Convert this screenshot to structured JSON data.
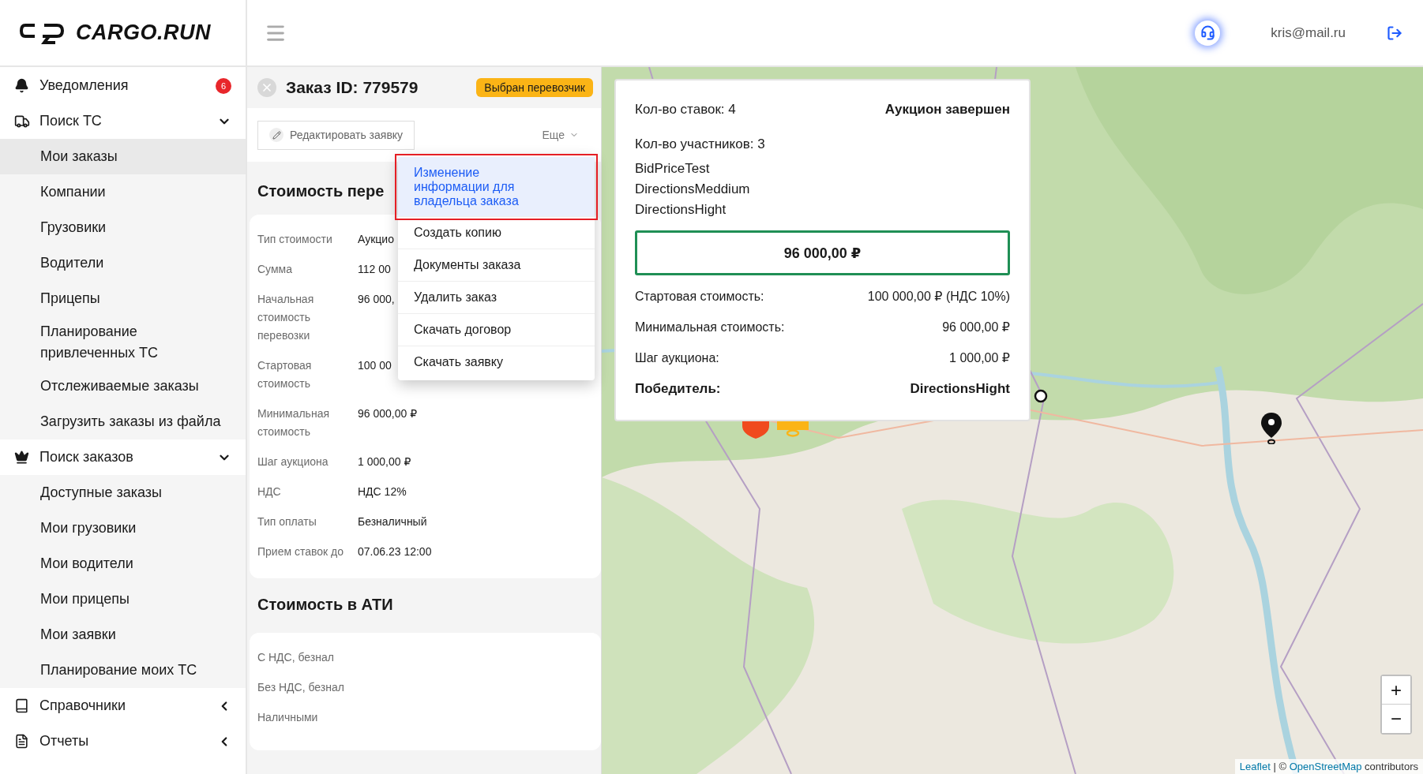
{
  "header": {
    "logo": "CARGO.RUN",
    "user_email": "kris@mail.ru"
  },
  "sidebar": {
    "items": [
      {
        "kind": "bell",
        "label": "Уведомления",
        "badge": "6"
      },
      {
        "kind": "truck",
        "label": "Поиск ТС",
        "expanded": true,
        "children": [
          {
            "label": "Мои заказы",
            "selected": true
          },
          {
            "label": "Компании",
            "selected": false
          },
          {
            "label": "Грузовики",
            "selected": false
          },
          {
            "label": "Водители",
            "selected": false
          },
          {
            "label": "Прицепы",
            "selected": false
          },
          {
            "label": "Планирование привлеченных ТС",
            "selected": false
          },
          {
            "label": "Отслеживаемые заказы",
            "selected": false
          },
          {
            "label": "Загрузить заказы из файла",
            "selected": false
          }
        ]
      },
      {
        "kind": "crown",
        "label": "Поиск заказов",
        "expanded": true,
        "children": [
          {
            "label": "Доступные заказы",
            "selected": false
          },
          {
            "label": "Мои грузовики",
            "selected": false
          },
          {
            "label": "Мои водители",
            "selected": false
          },
          {
            "label": "Мои прицепы",
            "selected": false
          },
          {
            "label": "Мои заявки",
            "selected": false
          },
          {
            "label": "Планирование моих ТС",
            "selected": false
          }
        ]
      },
      {
        "kind": "book",
        "label": "Справочники",
        "expanded": false
      },
      {
        "kind": "report",
        "label": "Отчеты",
        "expanded": false
      }
    ]
  },
  "order": {
    "title": "Заказ ID: 779579",
    "status": "Выбран перевозчик",
    "edit_button": "Редактировать заявку",
    "more_button": "Еще",
    "more_menu": [
      {
        "label": "Изменение информации для владельца заказа",
        "highlighted": true
      },
      {
        "label": "Создать копию",
        "highlighted": false
      },
      {
        "label": "Документы заказа",
        "highlighted": false
      },
      {
        "label": "Удалить заказ",
        "highlighted": false
      },
      {
        "label": "Скачать договор",
        "highlighted": false
      },
      {
        "label": "Скачать заявку",
        "highlighted": false
      }
    ],
    "cost": {
      "title": "Стоимость пере",
      "rows": [
        {
          "label": "Тип стоимости",
          "value": "Аукцио"
        },
        {
          "label": "Сумма",
          "value": "112 00"
        },
        {
          "label": "Начальная стоимость перевозки",
          "value": "96 000,"
        },
        {
          "label": "Стартовая стоимость",
          "value": "100 00"
        },
        {
          "label": "Минимальная стоимость",
          "value": "96 000,00 ₽"
        },
        {
          "label": "Шаг аукциона",
          "value": "1 000,00 ₽"
        },
        {
          "label": "НДС",
          "value": "НДС 12%"
        },
        {
          "label": "Тип оплаты",
          "value": "Безналичный"
        },
        {
          "label": "Прием ставок до",
          "value": "07.06.23 12:00"
        }
      ]
    },
    "ati": {
      "title": "Стоимость в АТИ",
      "rows": [
        {
          "label": "С НДС, безнал"
        },
        {
          "label": "Без НДС, безнал"
        },
        {
          "label": "Наличными"
        }
      ]
    }
  },
  "auction": {
    "bids": "Кол-во ставок: 4",
    "status": "Аукцион завершен",
    "participants_count": "Кол-во участников: 3",
    "participants": [
      "BidPriceTest",
      "DirectionsMeddium",
      "DirectionsHight"
    ],
    "best_price": "96 000,00 ₽",
    "details": [
      {
        "kind": "plain",
        "label": "Стартовая стоимость:",
        "value": "100 000,00 ₽ (НДС 10%)"
      },
      {
        "kind": "plain",
        "label": "Минимальная стоимость:",
        "value": "96 000,00 ₽"
      },
      {
        "kind": "plain",
        "label": "Шаг аукциона:",
        "value": "1 000,00 ₽"
      },
      {
        "kind": "winner",
        "label": "Победитель:",
        "value": "DirectionsHight"
      }
    ]
  },
  "map": {
    "kind": "picture",
    "zoom_in": "+",
    "zoom_out": "−",
    "attribution": {
      "leaflet_link": "Leaflet",
      "separator": "| ©",
      "osm_link": "OpenStreetMap",
      "suffix": "contributors"
    }
  }
}
